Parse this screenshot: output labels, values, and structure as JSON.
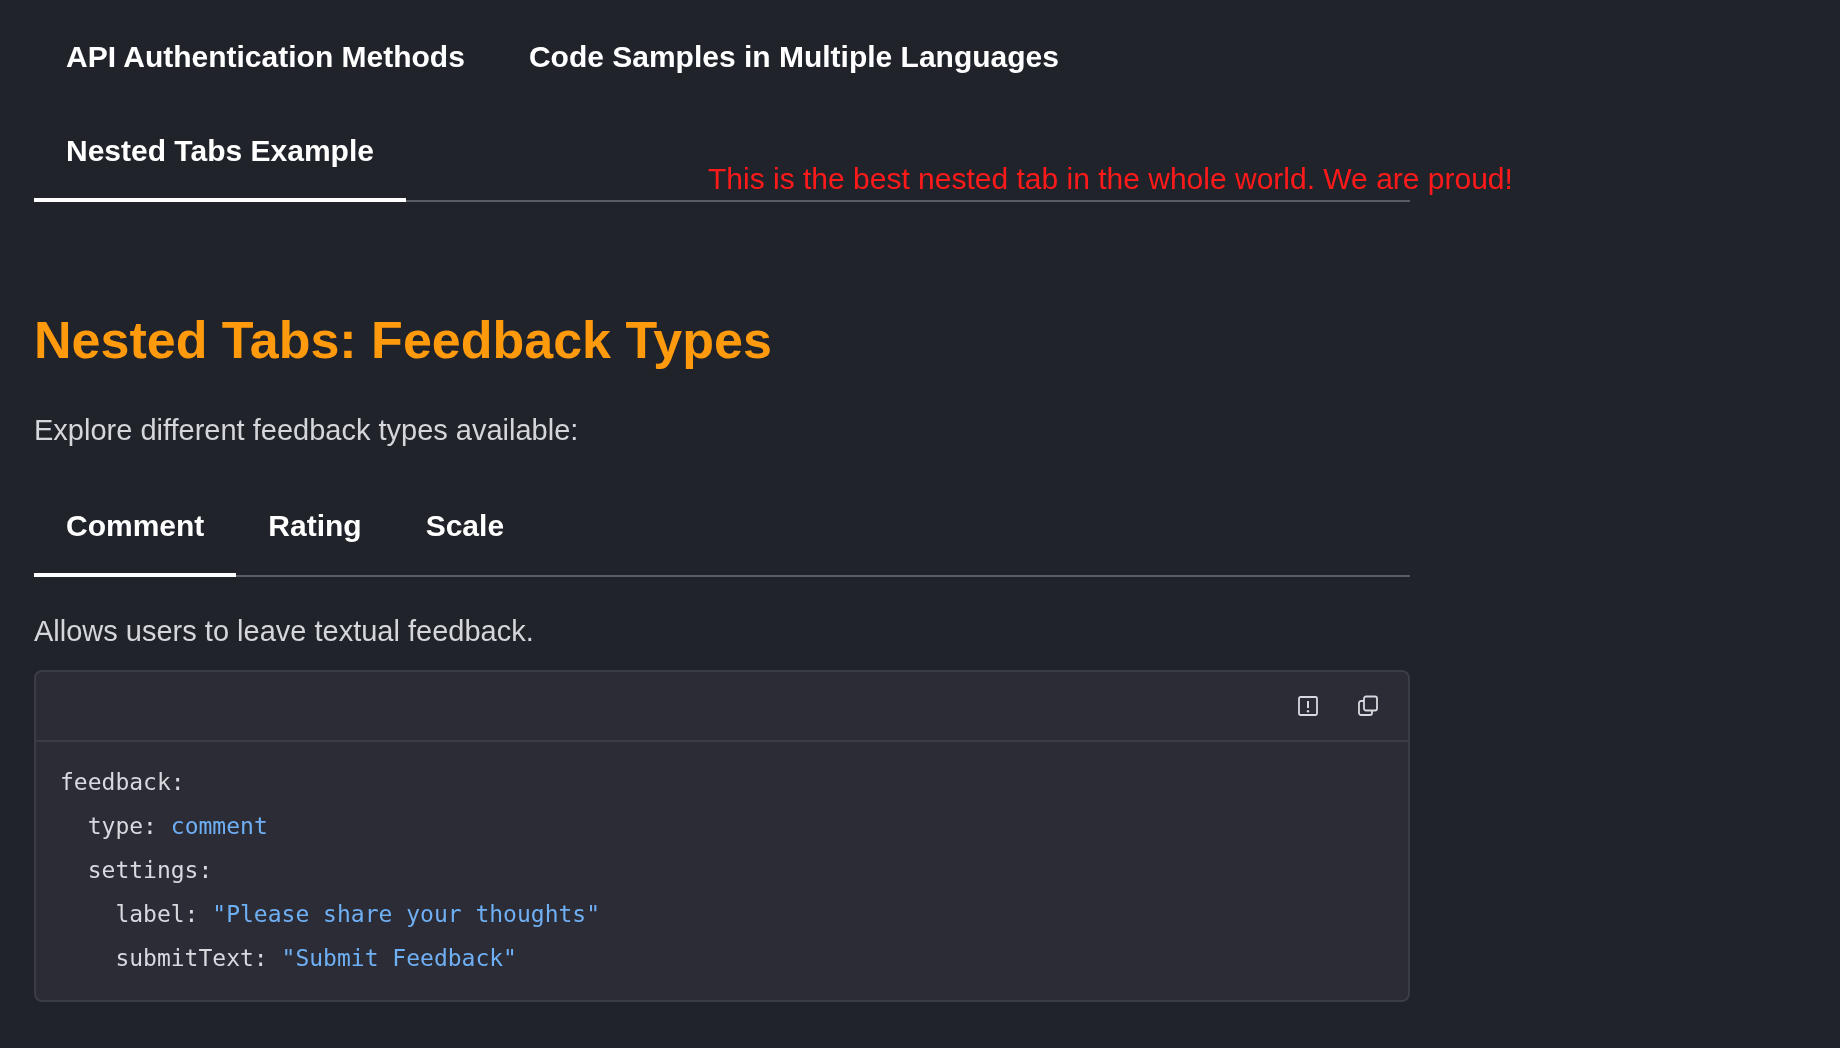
{
  "tabs": [
    {
      "label": "API Authentication Methods",
      "selected": false
    },
    {
      "label": "Code Samples in Multiple Languages",
      "selected": false
    },
    {
      "label": "Nested Tabs Example",
      "selected": true
    }
  ],
  "tab_note": "This is the best nested tab in the whole world. We are proud!",
  "heading": "Nested Tabs: Feedback Types",
  "intro": "Explore different feedback types available:",
  "sub_tabs": [
    {
      "label": "Comment",
      "selected": true
    },
    {
      "label": "Rating",
      "selected": false
    },
    {
      "label": "Scale",
      "selected": false
    }
  ],
  "description": "Allows users to leave textual feedback.",
  "code_block": {
    "buttons": [
      {
        "kind": "report"
      },
      {
        "kind": "copy"
      }
    ],
    "lines": [
      {
        "key": "feedback:",
        "children": [
          {
            "key": "type:",
            "value": "comment"
          },
          {
            "key": "settings:",
            "children": [
              {
                "key": "label:",
                "value": "\"Please share your thoughts\""
              },
              {
                "key": "submitText:",
                "value": "\"Submit Feedback\""
              }
            ]
          }
        ]
      }
    ]
  }
}
